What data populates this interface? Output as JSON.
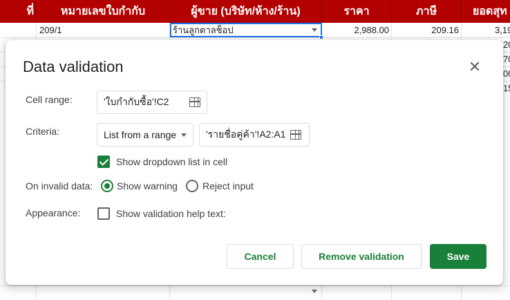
{
  "sheet": {
    "headers": [
      "ที่",
      "หมายเลขใบกำกับ",
      "ผู้ขาย (บริษัท/ห้าง/ร้าน)",
      "ราคา",
      "ภาษี",
      "ยอดสุท"
    ],
    "row1": {
      "invoice": "209/1",
      "vendor": "ร้านลูกตาลช็อป",
      "price": "2,988.00",
      "tax": "209.16",
      "total": "3,19"
    },
    "right_partial": [
      "20",
      "70",
      "00",
      "15"
    ],
    "header_color": "#b30000"
  },
  "dialog": {
    "title": "Data validation",
    "close_icon": "close-icon",
    "cell_range": {
      "label": "Cell range:",
      "value": "'ใบกำกับซื้อ'!C2"
    },
    "criteria": {
      "label": "Criteria:",
      "type": "List from a range",
      "range_value": "'รายชื่อคู่ค้า'!A2:A1"
    },
    "show_dropdown": {
      "label": "Show dropdown list in cell",
      "checked": true
    },
    "on_invalid": {
      "label": "On invalid data:",
      "option_warning": "Show warning",
      "option_reject": "Reject input",
      "selected": "warning"
    },
    "appearance": {
      "label": "Appearance:",
      "help_text_label": "Show validation help text:",
      "checked": false
    },
    "buttons": {
      "cancel": "Cancel",
      "remove": "Remove validation",
      "save": "Save"
    },
    "accent_color": "#188038"
  }
}
